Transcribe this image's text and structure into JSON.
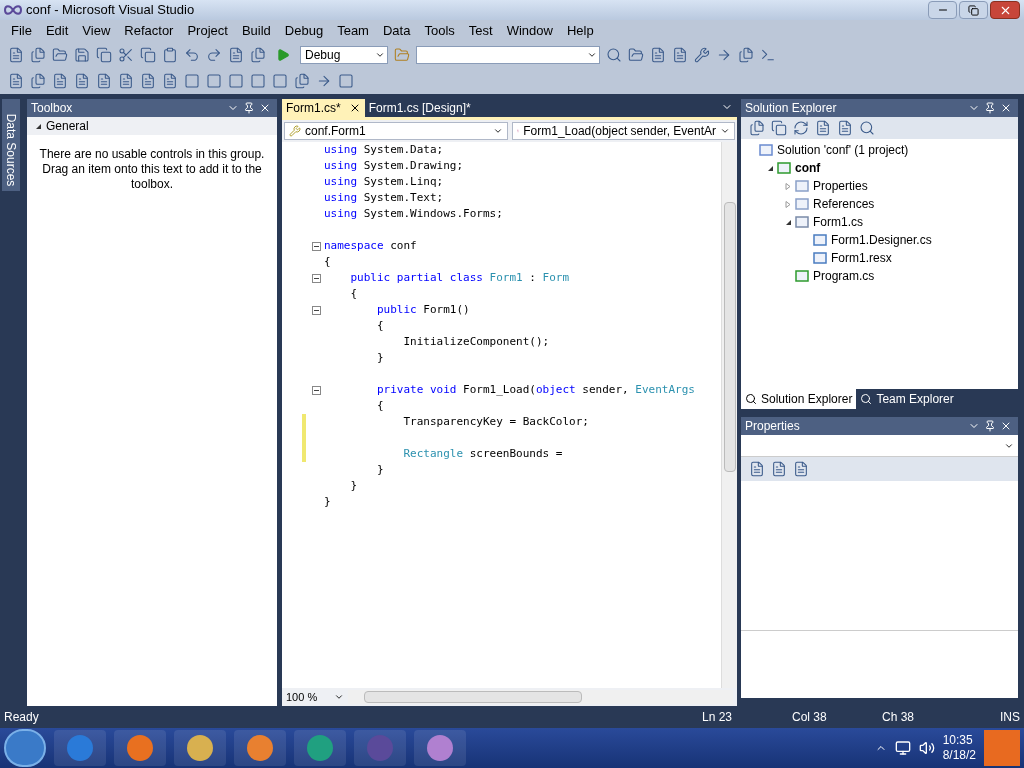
{
  "window": {
    "title": "conf - Microsoft Visual Studio"
  },
  "menu": [
    "File",
    "Edit",
    "View",
    "Refactor",
    "Project",
    "Build",
    "Debug",
    "Team",
    "Data",
    "Tools",
    "Test",
    "Window",
    "Help"
  ],
  "toolbar": {
    "configuration": "Debug"
  },
  "side_tab": "Data Sources",
  "toolbox": {
    "title": "Toolbox",
    "group": {
      "label": "General",
      "expanded": true
    },
    "message": "There are no usable controls in this group. Drag an item onto this text to add it to the toolbox."
  },
  "editor": {
    "tabs": [
      {
        "label": "Form1.cs*",
        "selected": true
      },
      {
        "label": "Form1.cs [Design]*",
        "selected": false
      }
    ],
    "type_dropdown": "conf.Form1",
    "member_dropdown": "Form1_Load(object sender, EventAr",
    "lines": [
      {
        "kind": "code",
        "fold": false,
        "changed": false,
        "tokens": [
          {
            "t": "using",
            "kind": "keyword"
          },
          {
            "t": " System.Data;",
            "kind": "plain"
          }
        ]
      },
      {
        "kind": "code",
        "fold": false,
        "changed": false,
        "tokens": [
          {
            "t": "using",
            "kind": "keyword"
          },
          {
            "t": " System.Drawing;",
            "kind": "plain"
          }
        ]
      },
      {
        "kind": "code",
        "fold": false,
        "changed": false,
        "tokens": [
          {
            "t": "using",
            "kind": "keyword"
          },
          {
            "t": " System.Linq;",
            "kind": "plain"
          }
        ]
      },
      {
        "kind": "code",
        "fold": false,
        "changed": false,
        "tokens": [
          {
            "t": "using",
            "kind": "keyword"
          },
          {
            "t": " System.Text;",
            "kind": "plain"
          }
        ]
      },
      {
        "kind": "code",
        "fold": false,
        "changed": false,
        "tokens": [
          {
            "t": "using",
            "kind": "keyword"
          },
          {
            "t": " System.Windows.Forms;",
            "kind": "plain"
          }
        ]
      },
      {
        "kind": "blank",
        "fold": false,
        "changed": false
      },
      {
        "kind": "code",
        "fold": true,
        "changed": false,
        "tokens": [
          {
            "t": "namespace",
            "kind": "keyword"
          },
          {
            "t": " conf",
            "kind": "plain"
          }
        ]
      },
      {
        "kind": "code",
        "fold": false,
        "changed": false,
        "tokens": [
          {
            "t": "{",
            "kind": "plain"
          }
        ]
      },
      {
        "kind": "code",
        "fold": true,
        "changed": false,
        "tokens": [
          {
            "t": "    public partial class",
            "kind": "keyword"
          },
          {
            "t": " Form1",
            "kind": "type"
          },
          {
            "t": " : ",
            "kind": "plain"
          },
          {
            "t": "Form",
            "kind": "type"
          }
        ]
      },
      {
        "kind": "code",
        "fold": false,
        "changed": false,
        "tokens": [
          {
            "t": "    {",
            "kind": "plain"
          }
        ]
      },
      {
        "kind": "code",
        "fold": true,
        "changed": false,
        "tokens": [
          {
            "t": "        public",
            "kind": "keyword"
          },
          {
            "t": " Form1()",
            "kind": "plain"
          }
        ]
      },
      {
        "kind": "code",
        "fold": false,
        "changed": false,
        "tokens": [
          {
            "t": "        {",
            "kind": "plain"
          }
        ]
      },
      {
        "kind": "code",
        "fold": false,
        "changed": false,
        "tokens": [
          {
            "t": "            InitializeComponent();",
            "kind": "plain"
          }
        ]
      },
      {
        "kind": "code",
        "fold": false,
        "changed": false,
        "tokens": [
          {
            "t": "        }",
            "kind": "plain"
          }
        ]
      },
      {
        "kind": "blank",
        "fold": false,
        "changed": false
      },
      {
        "kind": "code",
        "fold": true,
        "changed": false,
        "tokens": [
          {
            "t": "        private void",
            "kind": "keyword"
          },
          {
            "t": " Form1_Load(",
            "kind": "plain"
          },
          {
            "t": "object",
            "kind": "keyword"
          },
          {
            "t": " sender, ",
            "kind": "plain"
          },
          {
            "t": "EventArgs",
            "kind": "type"
          }
        ]
      },
      {
        "kind": "code",
        "fold": false,
        "changed": false,
        "tokens": [
          {
            "t": "        {",
            "kind": "plain"
          }
        ]
      },
      {
        "kind": "code",
        "fold": false,
        "changed": true,
        "tokens": [
          {
            "t": "            TransparencyKey = BackColor;",
            "kind": "plain"
          }
        ]
      },
      {
        "kind": "blank",
        "fold": false,
        "changed": true
      },
      {
        "kind": "code",
        "fold": false,
        "changed": true,
        "tokens": [
          {
            "t": "            Rectangle",
            "kind": "type"
          },
          {
            "t": " screenBounds = ",
            "kind": "plain"
          }
        ]
      },
      {
        "kind": "code",
        "fold": false,
        "changed": false,
        "tokens": [
          {
            "t": "        }",
            "kind": "plain"
          }
        ]
      },
      {
        "kind": "code",
        "fold": false,
        "changed": false,
        "tokens": [
          {
            "t": "    }",
            "kind": "plain"
          }
        ]
      },
      {
        "kind": "code",
        "fold": false,
        "changed": false,
        "tokens": [
          {
            "t": "}",
            "kind": "plain"
          }
        ]
      }
    ],
    "zoom": "100 %"
  },
  "solution_explorer": {
    "title": "Solution Explorer",
    "tree": [
      {
        "label": "Solution 'conf' (1 project)",
        "kind": "solution",
        "bold": false,
        "children": [
          {
            "label": "conf",
            "kind": "project",
            "bold": true,
            "expanded": true,
            "children": [
              {
                "label": "Properties",
                "kind": "folder",
                "bold": false,
                "expanded": false
              },
              {
                "label": "References",
                "kind": "folder",
                "bold": false,
                "expanded": false
              },
              {
                "label": "Form1.cs",
                "kind": "form",
                "bold": false,
                "expanded": true,
                "children": [
                  {
                    "label": "Form1.Designer.cs",
                    "kind": "file",
                    "bold": false
                  },
                  {
                    "label": "Form1.resx",
                    "kind": "file",
                    "bold": false
                  }
                ]
              },
              {
                "label": "Program.cs",
                "kind": "code",
                "bold": false
              }
            ]
          }
        ]
      }
    ],
    "tabs": [
      {
        "label": "Solution Explorer",
        "selected": true
      },
      {
        "label": "Team Explorer",
        "selected": false
      }
    ]
  },
  "properties": {
    "title": "Properties"
  },
  "status_bar": {
    "message": "Ready",
    "line": "Ln 23",
    "column": "Col 38",
    "char": "Ch 38",
    "mode": "INS"
  },
  "taskbar": {
    "time": "10:35",
    "date": "8/18/2"
  }
}
